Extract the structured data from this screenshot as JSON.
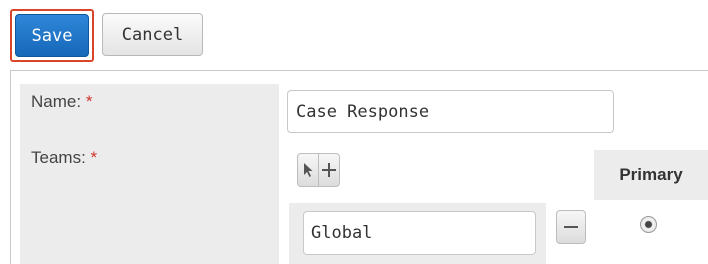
{
  "toolbar": {
    "save_label": "Save",
    "cancel_label": "Cancel"
  },
  "form": {
    "name_label": "Name:",
    "name_required": "*",
    "name_value": "Case Response",
    "teams_label": "Teams:",
    "teams_required": "*",
    "primary_header": "Primary",
    "team_value": "Global",
    "team_is_primary": true
  },
  "icons": {
    "select": "cursor-arrow-icon",
    "add": "plus-icon",
    "remove": "minus-icon"
  },
  "colors": {
    "save_button": "#1e73c8",
    "highlight": "#d9442b",
    "required": "#d0342c"
  }
}
